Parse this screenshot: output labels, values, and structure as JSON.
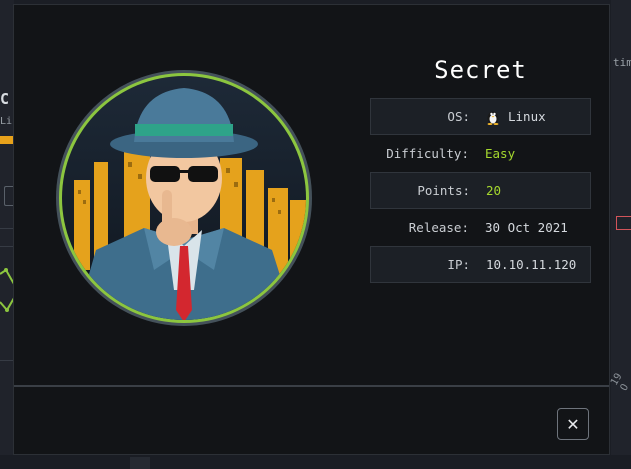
{
  "modal": {
    "title": "Secret",
    "avatar": "secret-agent-avatar",
    "info": [
      {
        "label": "OS:",
        "value": "Linux",
        "icon": "tux-linux-icon"
      },
      {
        "label": "Difficulty:",
        "value": "Easy",
        "value_color": "#a5d82e"
      },
      {
        "label": "Points:",
        "value": "20",
        "value_color": "#a5d82e"
      },
      {
        "label": "Release:",
        "value": "30 Oct 2021"
      },
      {
        "label": "IP:",
        "value": "10.10.11.120"
      }
    ],
    "close_label": "✕"
  },
  "background": {
    "left_title_fragment": "C",
    "left_sub_fragment": "Li",
    "right_text_fragment": "tim",
    "right_date_fragment": "19 O"
  },
  "colors": {
    "accent_green": "#a5d82e",
    "ring_green": "#8cc63f",
    "modal_bg": "#121417"
  }
}
